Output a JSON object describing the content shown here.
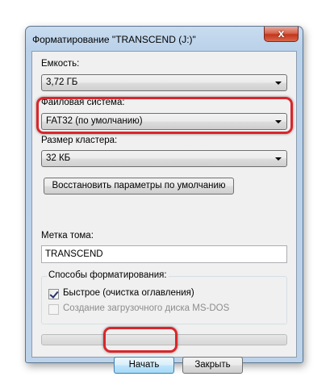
{
  "window": {
    "title": "Форматирование \"TRANSCEND (J:)\"",
    "close_glyph": "x"
  },
  "capacity": {
    "label": "Емкость:",
    "value": "3,72 ГБ"
  },
  "filesystem": {
    "label": "Файловая система:",
    "value": "FAT32 (по умолчанию)"
  },
  "cluster": {
    "label": "Размер кластера:",
    "value": "32 КБ"
  },
  "restore_defaults_button": "Восстановить параметры по умолчанию",
  "volume_label": {
    "label": "Метка тома:",
    "value": "TRANSCEND"
  },
  "format_options": {
    "title": "Способы форматирования:",
    "quick_format": {
      "label": "Быстрое (очистка оглавления)",
      "checked": true,
      "enabled": true
    },
    "msdos_boot_disk": {
      "label": "Создание загрузочного диска MS-DOS",
      "checked": false,
      "enabled": false
    }
  },
  "progress": {
    "value": 0
  },
  "buttons": {
    "start": "Начать",
    "close": "Закрыть"
  },
  "colors": {
    "highlight": "#d9262b",
    "progress_fill": "#37b24a"
  }
}
